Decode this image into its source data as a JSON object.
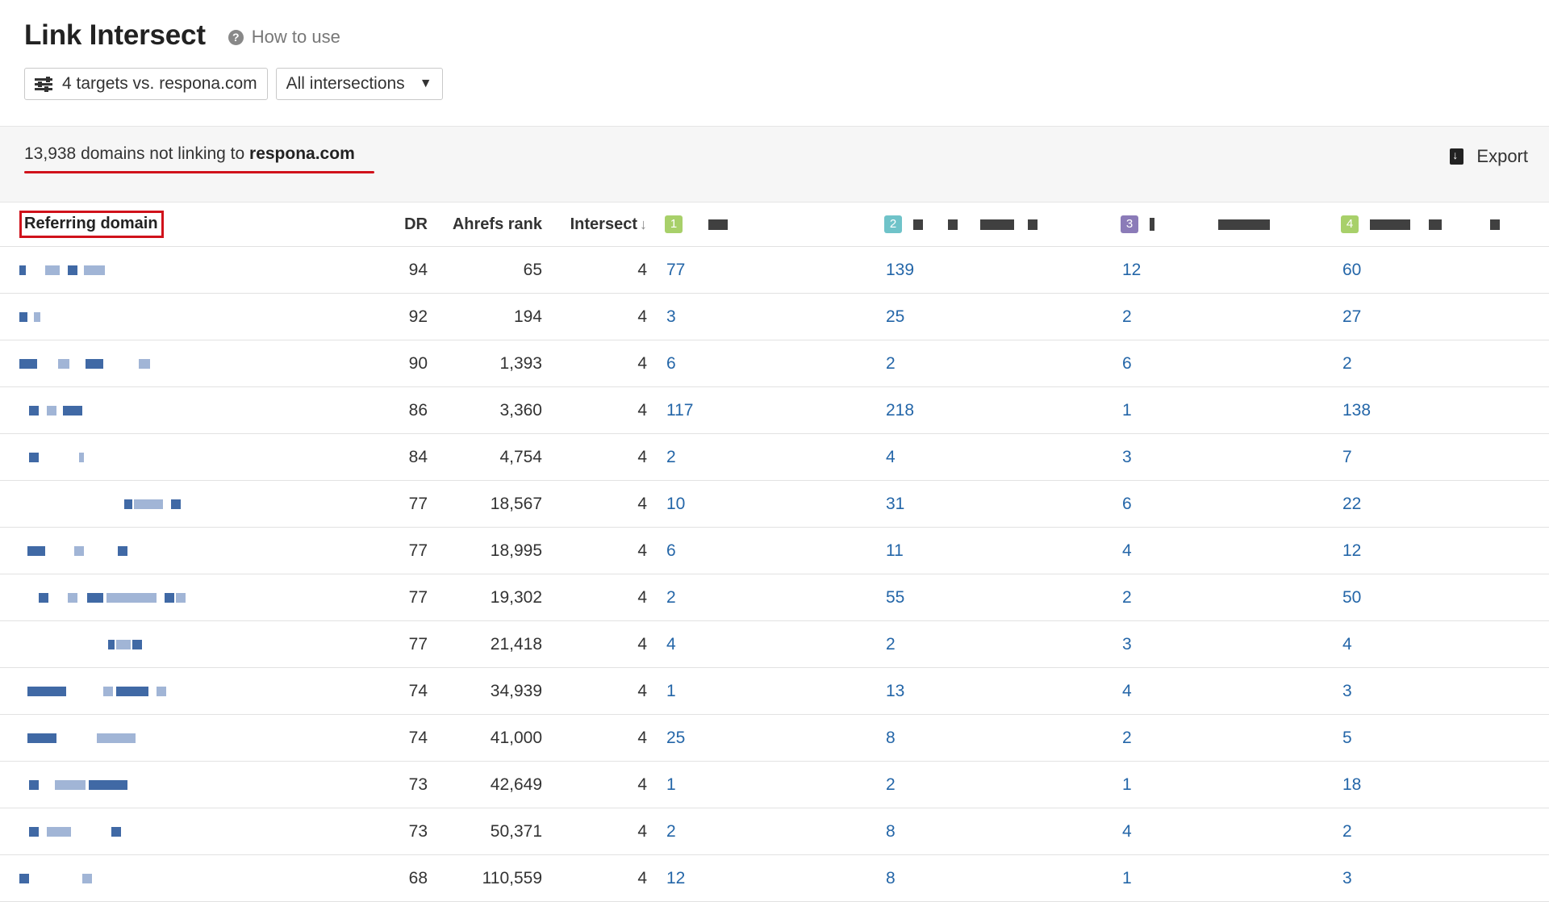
{
  "header": {
    "title": "Link Intersect",
    "help_label": "How to use",
    "targets_button": "4 targets vs. respona.com",
    "intersections_select": "All intersections"
  },
  "summary": {
    "count_text": "13,938 domains not linking to",
    "domain": "respona.com",
    "export_label": "Export"
  },
  "colors": {
    "accent_red": "#d0121b",
    "link_blue": "#2466a8",
    "badge_1": "#a8d06a",
    "badge_2": "#6fc3c9",
    "badge_3": "#8b7bb8",
    "badge_4": "#a8d06a"
  },
  "table": {
    "columns": {
      "referring_domain": "Referring domain",
      "dr": "DR",
      "ahrefs_rank": "Ahrefs rank",
      "intersect": "Intersect",
      "t1": "1",
      "t2": "2",
      "t3": "3",
      "t4": "4"
    },
    "rows": [
      {
        "dr": "94",
        "rank": "65",
        "intersect": "4",
        "t1": "77",
        "t2": "139",
        "t3": "12",
        "t4": "60"
      },
      {
        "dr": "92",
        "rank": "194",
        "intersect": "4",
        "t1": "3",
        "t2": "25",
        "t3": "2",
        "t4": "27"
      },
      {
        "dr": "90",
        "rank": "1,393",
        "intersect": "4",
        "t1": "6",
        "t2": "2",
        "t3": "6",
        "t4": "2"
      },
      {
        "dr": "86",
        "rank": "3,360",
        "intersect": "4",
        "t1": "117",
        "t2": "218",
        "t3": "1",
        "t4": "138"
      },
      {
        "dr": "84",
        "rank": "4,754",
        "intersect": "4",
        "t1": "2",
        "t2": "4",
        "t3": "3",
        "t4": "7"
      },
      {
        "dr": "77",
        "rank": "18,567",
        "intersect": "4",
        "t1": "10",
        "t2": "31",
        "t3": "6",
        "t4": "22"
      },
      {
        "dr": "77",
        "rank": "18,995",
        "intersect": "4",
        "t1": "6",
        "t2": "11",
        "t3": "4",
        "t4": "12"
      },
      {
        "dr": "77",
        "rank": "19,302",
        "intersect": "4",
        "t1": "2",
        "t2": "55",
        "t3": "2",
        "t4": "50"
      },
      {
        "dr": "77",
        "rank": "21,418",
        "intersect": "4",
        "t1": "4",
        "t2": "2",
        "t3": "3",
        "t4": "4"
      },
      {
        "dr": "74",
        "rank": "34,939",
        "intersect": "4",
        "t1": "1",
        "t2": "13",
        "t3": "4",
        "t4": "3"
      },
      {
        "dr": "74",
        "rank": "41,000",
        "intersect": "4",
        "t1": "25",
        "t2": "8",
        "t3": "2",
        "t4": "5"
      },
      {
        "dr": "73",
        "rank": "42,649",
        "intersect": "4",
        "t1": "1",
        "t2": "2",
        "t3": "1",
        "t4": "18"
      },
      {
        "dr": "73",
        "rank": "50,371",
        "intersect": "4",
        "t1": "2",
        "t2": "8",
        "t3": "4",
        "t4": "2"
      },
      {
        "dr": "68",
        "rank": "110,559",
        "intersect": "4",
        "t1": "12",
        "t2": "8",
        "t3": "1",
        "t4": "3"
      }
    ]
  }
}
